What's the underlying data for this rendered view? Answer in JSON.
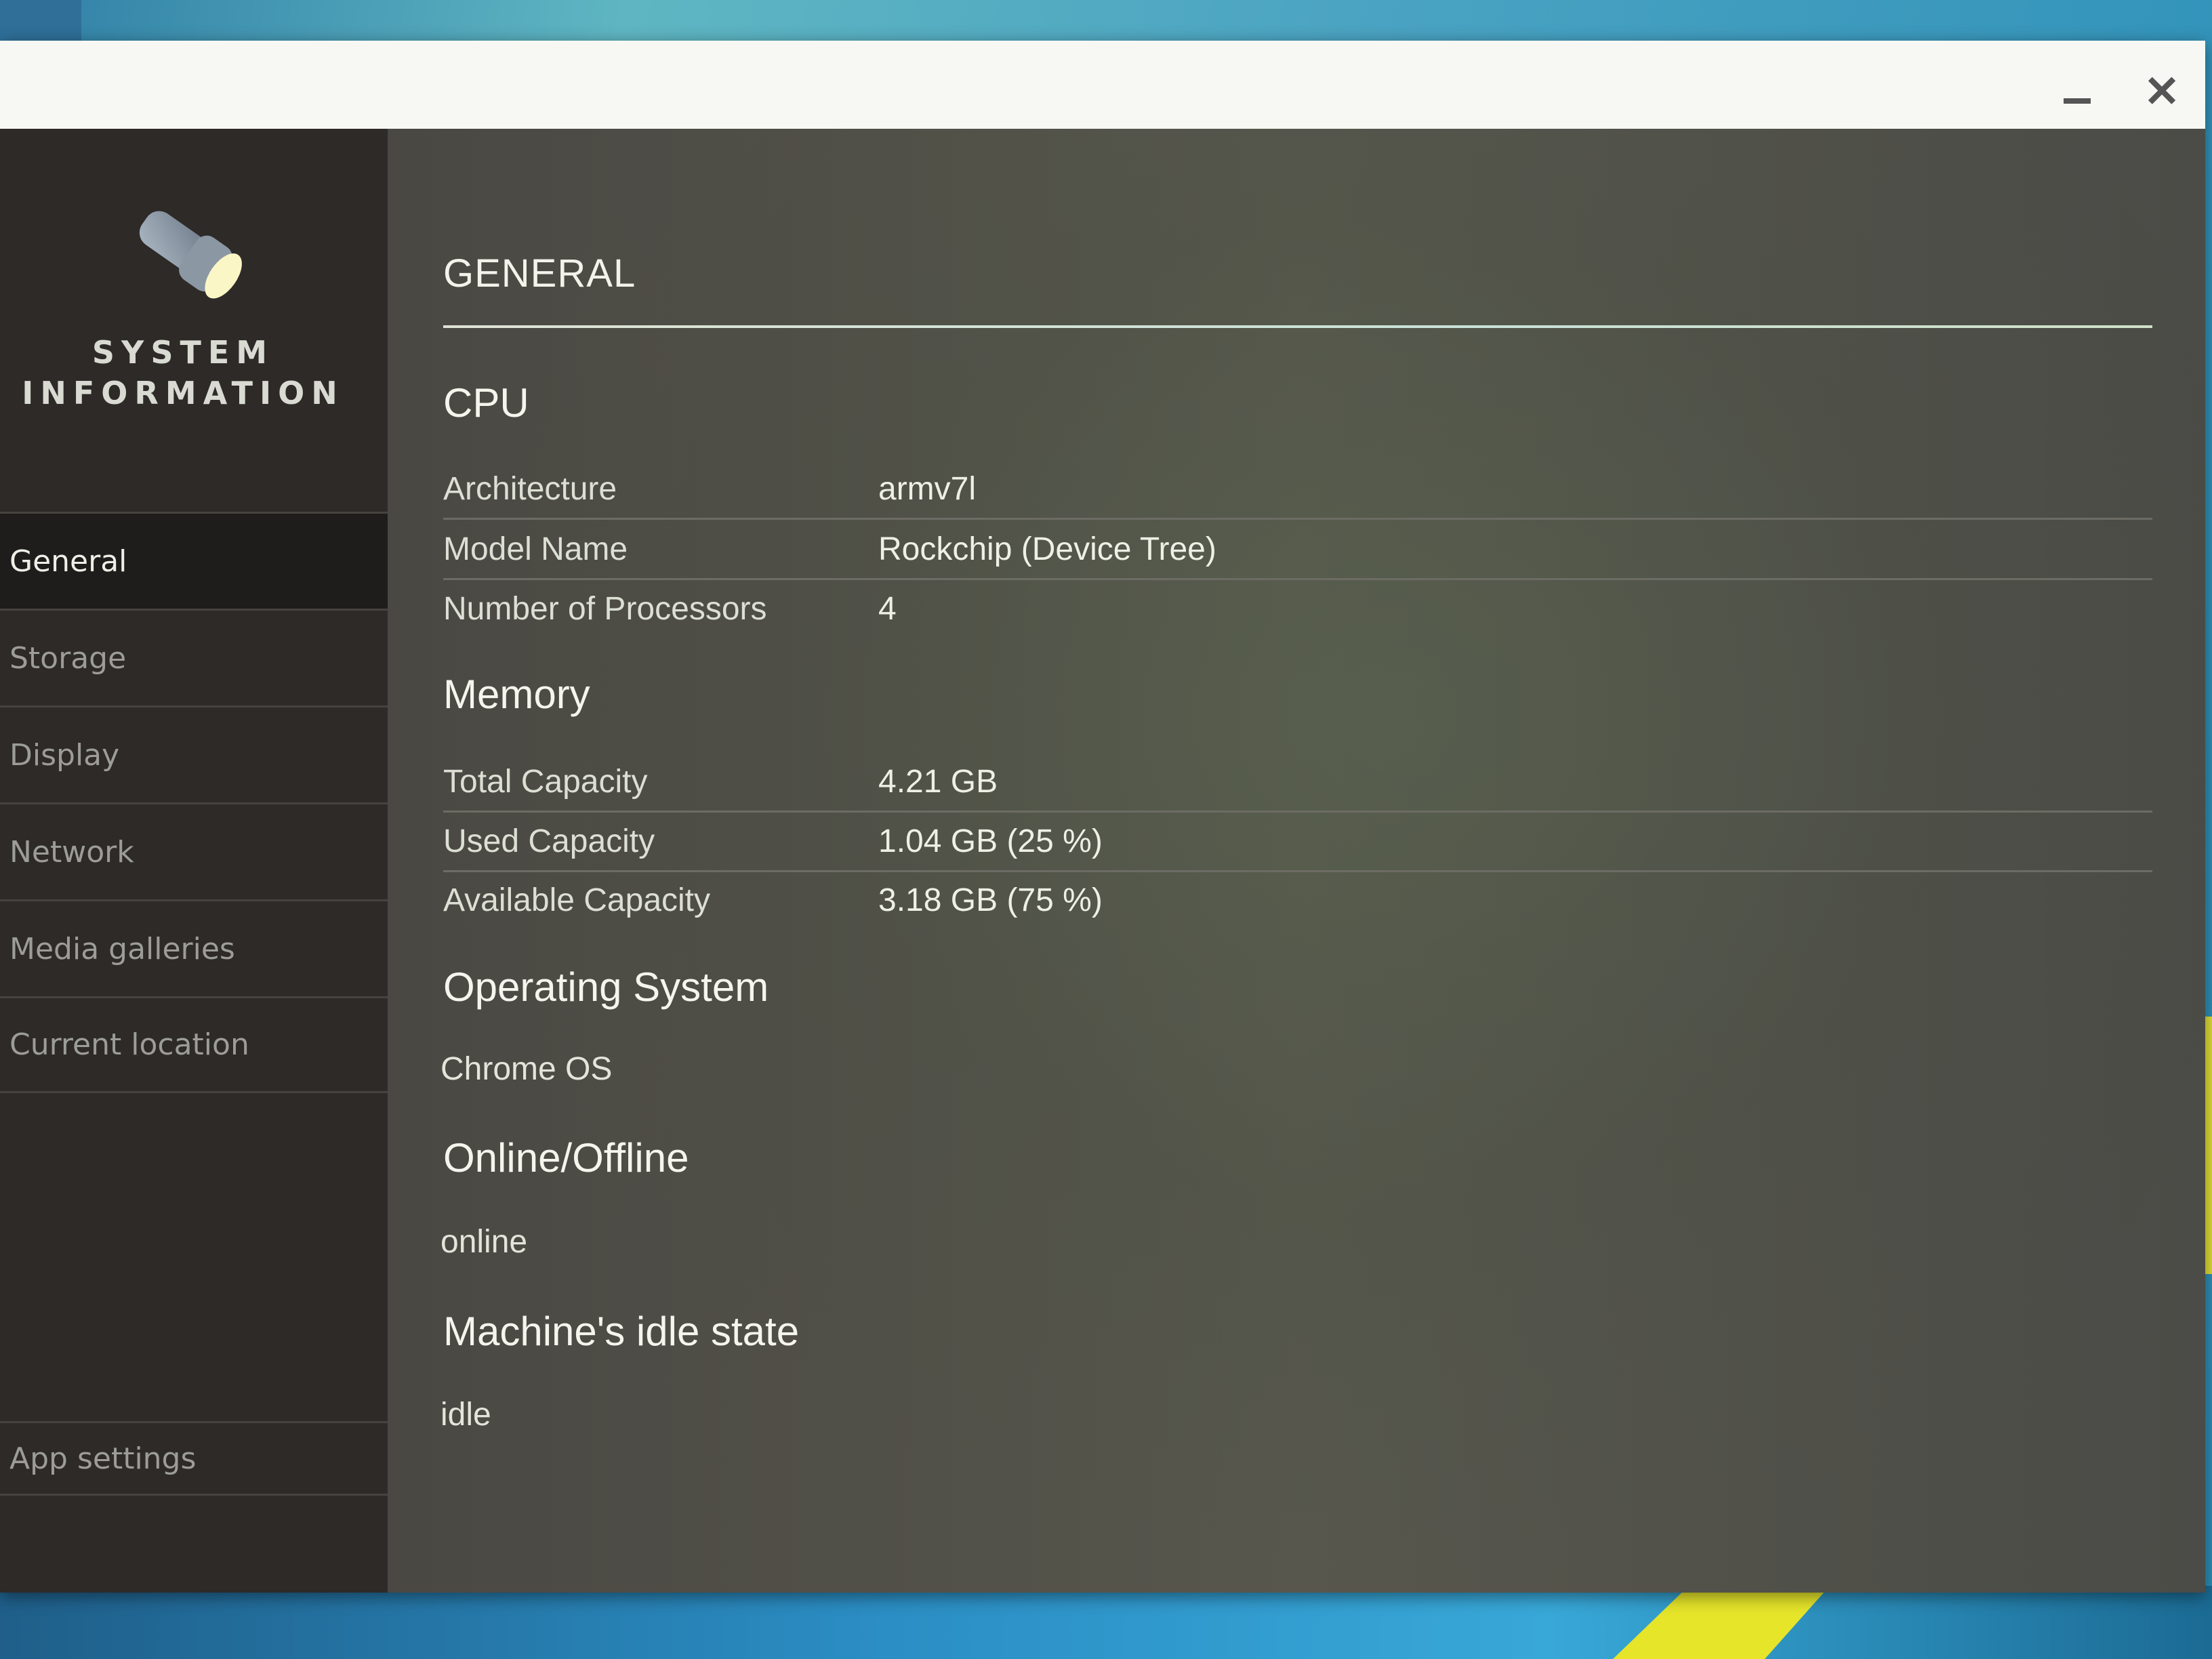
{
  "window": {
    "minimize_label": "minimize",
    "close_label": "close",
    "minimize_glyph": "",
    "close_glyph": "✕"
  },
  "sidebar": {
    "app_icon": "flashlight-icon",
    "app_title_line1": "SYSTEM",
    "app_title_line2": "INFORMATION",
    "items": [
      {
        "label": "General",
        "active": true
      },
      {
        "label": "Storage",
        "active": false
      },
      {
        "label": "Display",
        "active": false
      },
      {
        "label": "Network",
        "active": false
      },
      {
        "label": "Media galleries",
        "active": false
      },
      {
        "label": "Current location",
        "active": false
      }
    ],
    "bottom_item": {
      "label": "App settings"
    }
  },
  "main": {
    "title": "GENERAL",
    "cpu": {
      "heading": "CPU",
      "rows": [
        {
          "label": "Architecture",
          "value": "armv7l"
        },
        {
          "label": "Model Name",
          "value": "Rockchip (Device Tree)"
        },
        {
          "label": "Number of Processors",
          "value": "4"
        }
      ]
    },
    "memory": {
      "heading": "Memory",
      "rows": [
        {
          "label": "Total Capacity",
          "value": "4.21 GB"
        },
        {
          "label": "Used Capacity",
          "value": "1.04 GB (25 %)"
        },
        {
          "label": "Available Capacity",
          "value": "3.18 GB (75 %)"
        }
      ]
    },
    "os": {
      "heading": "Operating System",
      "value": "Chrome OS"
    },
    "online": {
      "heading": "Online/Offline",
      "value": "online"
    },
    "idle": {
      "heading": "Machine's idle state",
      "value": "idle"
    }
  },
  "colors": {
    "titlebar": "#f7f8f4",
    "sidebar_bg": "#2d2a28",
    "sidebar_active_bg": "#1f1d1b",
    "content_bg": "#4f4e48",
    "text_primary": "#eef0e6",
    "text_muted": "#9c9d97"
  }
}
